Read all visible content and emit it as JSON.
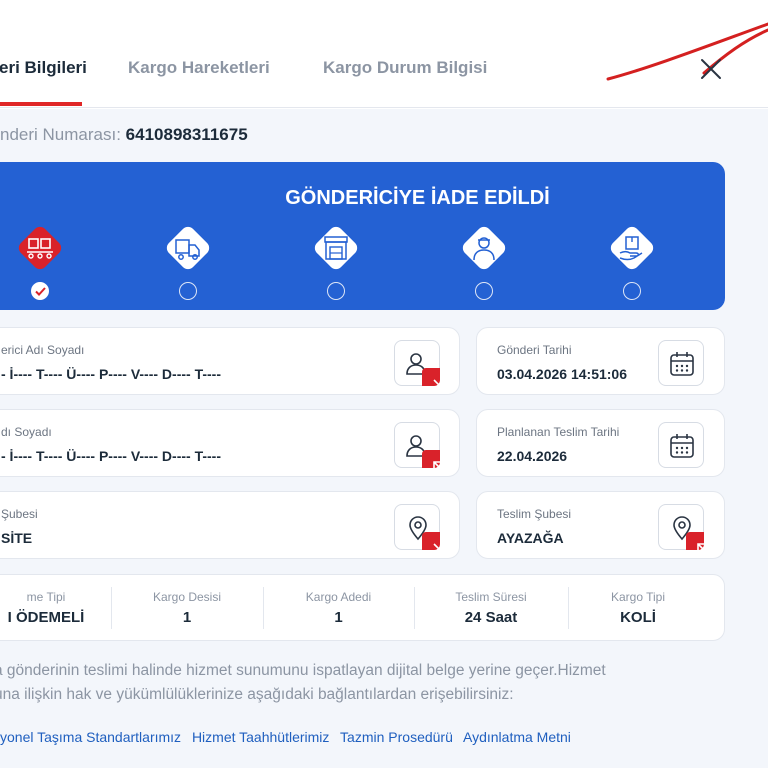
{
  "tabs": [
    {
      "label": "eri Bilgileri",
      "active": true
    },
    {
      "label": "Kargo Hareketleri",
      "active": false
    },
    {
      "label": "Kargo Durum Bilgisi",
      "active": false
    }
  ],
  "tracking": {
    "label": "nderi Numarası:",
    "number": "6410898311675"
  },
  "status": {
    "title": "GÖNDERİCİYE İADE EDİLDİ",
    "steps": [
      {
        "icon": "packages-conveyor-icon",
        "done": true
      },
      {
        "icon": "delivery-truck-icon",
        "done": false
      },
      {
        "icon": "warehouse-icon",
        "done": false
      },
      {
        "icon": "courier-icon",
        "done": false
      },
      {
        "icon": "hand-package-icon",
        "done": false
      }
    ],
    "colors": {
      "card": "#2461d3",
      "active_step": "#d9222a"
    }
  },
  "sender": {
    "label": "erici Adı Soyadı",
    "value": "- İ---- T---- Ü---- P---- V---- D---- T----"
  },
  "receiver": {
    "label": "dı Soyadı",
    "value": "- İ---- T---- Ü---- P---- V---- D---- T----"
  },
  "origin_branch": {
    "label": "Şubesi",
    "value": "SİTE"
  },
  "send_date": {
    "label": "Gönderi Tarihi",
    "value": "03.04.2026 14:51:06"
  },
  "planned_date": {
    "label": "Planlanan Teslim Tarihi",
    "value": "22.04.2026"
  },
  "delivery_branch": {
    "label": "Teslim Şubesi",
    "value": "AYAZAĞA"
  },
  "info": [
    {
      "label": "me Tipi",
      "value": "I ÖDEMELİ"
    },
    {
      "label": "Kargo Desisi",
      "value": "1"
    },
    {
      "label": "Kargo Adedi",
      "value": "1"
    },
    {
      "label": "Teslim Süresi",
      "value": "24 Saat"
    },
    {
      "label": "Kargo Tipi",
      "value": "KOLİ"
    }
  ],
  "note": {
    "line1": "a gönderinin teslimi halinde hizmet sunumunu ispatlayan dijital belge yerine geçer.Hizmet",
    "line2": "una ilişkin hak ve yükümlülüklerinize aşağıdaki bağlantılardan erişebilirsiniz:"
  },
  "links": [
    "yonel Taşıma Standartlarımız",
    "Hizmet Taahhütlerimiz",
    "Tazmin Prosedürü",
    "Aydınlatma Metni"
  ]
}
